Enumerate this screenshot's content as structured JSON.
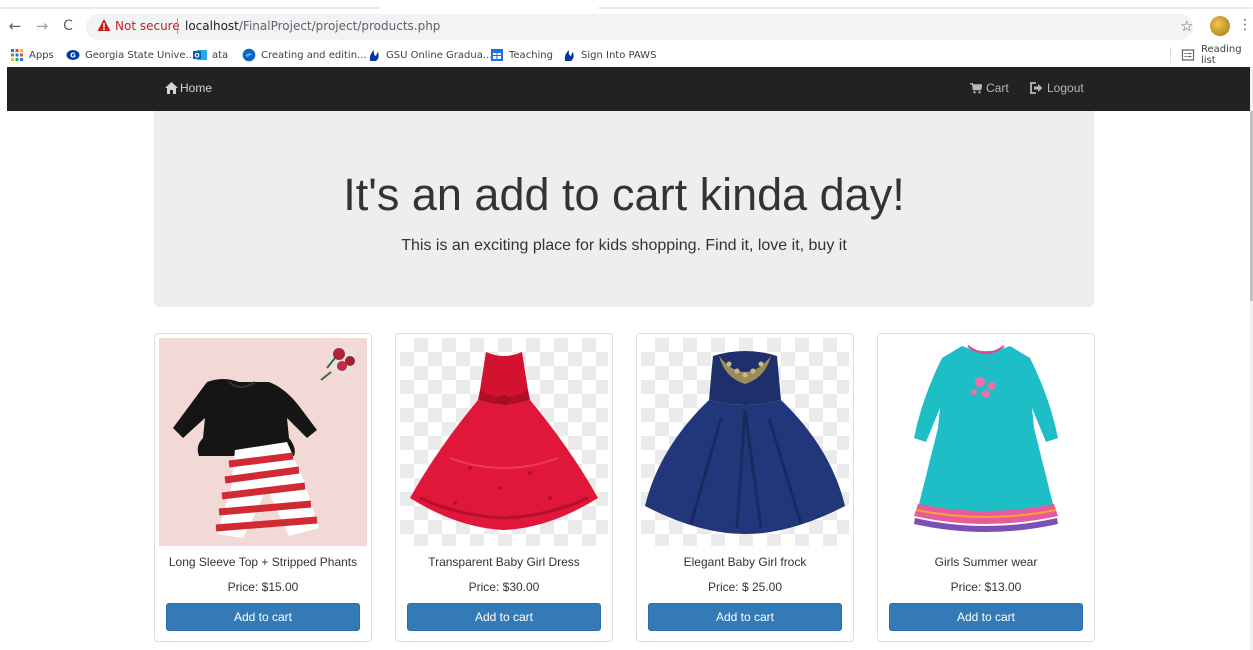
{
  "browser": {
    "nav": {
      "back_icon": "←",
      "forward_icon": "→",
      "reload_icon": "C"
    },
    "security_label": "Not secure",
    "url_host": "localhost",
    "url_path": "/FinalProject/project/products.php",
    "bookmarks": [
      {
        "label": "Apps",
        "icon": "apps-grid-icon"
      },
      {
        "label": "Georgia State Unive...",
        "icon": "gsu-logo-icon"
      },
      {
        "label": "ata",
        "icon": "outlook-icon"
      },
      {
        "label": "Creating and editin...",
        "icon": "edge-icon"
      },
      {
        "label": "GSU Online Gradua...",
        "icon": "gsu-flame-icon"
      },
      {
        "label": "Teaching",
        "icon": "calendar-icon"
      },
      {
        "label": "Sign Into PAWS",
        "icon": "gsu-flame-icon"
      }
    ],
    "reading_list": "Reading list"
  },
  "navbar": {
    "home": "Home",
    "cart": "Cart",
    "logout": "Logout"
  },
  "jumbotron": {
    "title": "It's an add to cart kinda day!",
    "subtitle": "This is an exciting place for kids shopping. Find it, love it, buy it"
  },
  "products": [
    {
      "name": "Long Sleeve Top + Stripped Phants",
      "price": "Price: $15.00",
      "button": "Add to cart"
    },
    {
      "name": "Transparent Baby Girl Dress",
      "price": "Price: $30.00",
      "button": "Add to cart"
    },
    {
      "name": "Elegant Baby Girl frock",
      "price": "Price: $ 25.00",
      "button": "Add to cart"
    },
    {
      "name": "Girls Summer wear",
      "price": "Price: $13.00",
      "button": "Add to cart"
    }
  ],
  "colors": {
    "navbar_bg": "#222222",
    "jumbotron_bg": "#eeeeee",
    "button_primary": "#337ab7",
    "not_secure_red": "#c5221f"
  }
}
